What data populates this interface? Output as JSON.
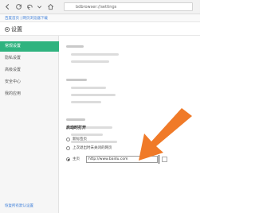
{
  "browser": {
    "address": "bdbrowser://settings",
    "bookmark_text": "百度首页 | 网页浏览器下载"
  },
  "settings": {
    "title": "设置",
    "sidebar": {
      "items": [
        {
          "label": "常规设置",
          "active": true
        },
        {
          "label": "隐私设置",
          "active": false
        },
        {
          "label": "高级设置",
          "active": false
        },
        {
          "label": "安全中心",
          "active": false
        },
        {
          "label": "我的应用",
          "active": false
        }
      ],
      "footer": "恢复所有默认设置"
    },
    "startup": {
      "title": "启动时打开",
      "options": [
        {
          "label": "新标签页",
          "checked": false
        },
        {
          "label": "上次退出时未关闭的网页",
          "checked": false
        },
        {
          "label": "主页",
          "checked": true
        }
      ],
      "homepage_url": "http://www.baidu.com"
    }
  },
  "colors": {
    "accent": "#2fb37f",
    "arrow": "#f07a28",
    "link": "#3b7dd8"
  },
  "icons": [
    "back-icon",
    "forward-icon",
    "refresh-icon",
    "home-icon",
    "settings-gear-icon"
  ]
}
